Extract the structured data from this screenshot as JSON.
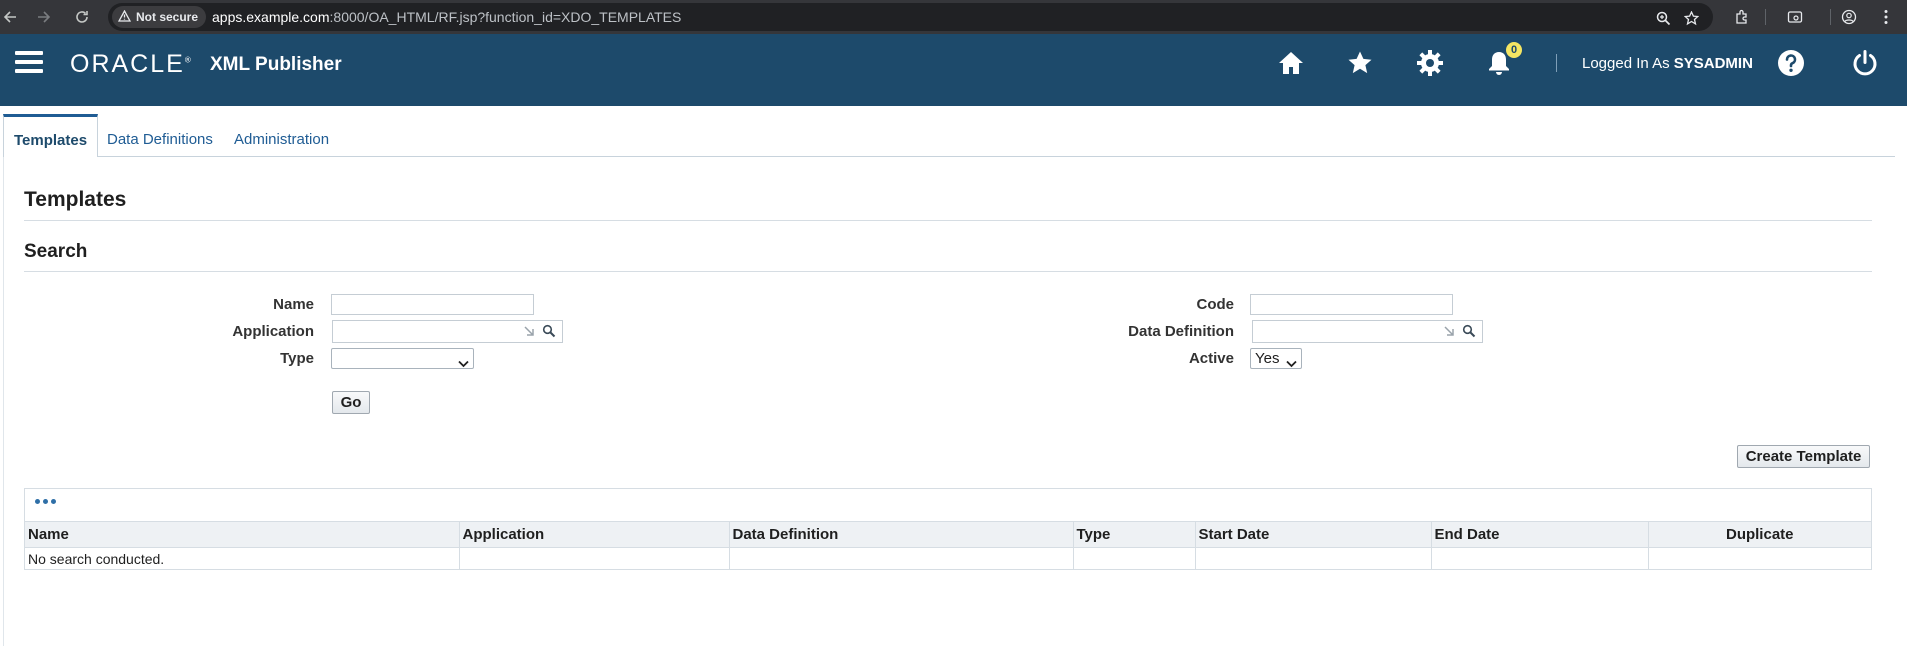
{
  "browser": {
    "security_label": "Not secure",
    "url_host": "apps.example.com",
    "url_path": ":8000/OA_HTML/RF.jsp?function_id=XDO_TEMPLATES"
  },
  "header": {
    "logo": "ORACLE",
    "product": "XML Publisher",
    "notification_count": "0",
    "logged_in_prefix": "Logged In As ",
    "username": "SYSADMIN"
  },
  "tabs": [
    {
      "label": "Templates",
      "active": true
    },
    {
      "label": "Data Definitions",
      "active": false
    },
    {
      "label": "Administration",
      "active": false
    }
  ],
  "page": {
    "title": "Templates",
    "search_title": "Search"
  },
  "search": {
    "name_label": "Name",
    "name_value": "",
    "application_label": "Application",
    "application_value": "",
    "type_label": "Type",
    "type_value": "",
    "code_label": "Code",
    "code_value": "",
    "data_definition_label": "Data Definition",
    "data_definition_value": "",
    "active_label": "Active",
    "active_value": "Yes",
    "go_label": "Go"
  },
  "actions": {
    "create_template_label": "Create Template"
  },
  "results": {
    "columns": [
      "Name",
      "Application",
      "Data Definition",
      "Type",
      "Start Date",
      "End Date",
      "Duplicate"
    ],
    "empty_message": "No search conducted."
  }
}
